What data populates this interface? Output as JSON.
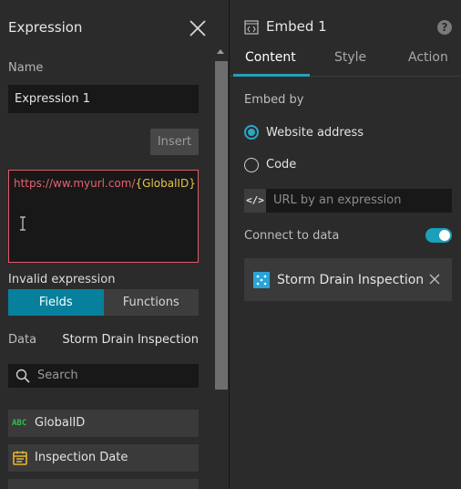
{
  "left": {
    "title": "Expression",
    "name_label": "Name",
    "name_value": "Expression 1",
    "insert_label": "Insert",
    "expression": {
      "url_part": "https://ww.myurl.com/",
      "field_part": "{GlobalID}"
    },
    "error_text": "Invalid expression",
    "tabs": [
      {
        "label": "Fields",
        "active": true
      },
      {
        "label": "Functions",
        "active": false
      }
    ],
    "data_label": "Data",
    "data_value": "Storm Drain Inspection",
    "search_placeholder": "Search",
    "fields": [
      {
        "icon": "abc-string-icon",
        "icon_text": "ABC",
        "name": "GlobalID"
      },
      {
        "icon": "calendar-date-icon",
        "name": "Inspection Date"
      }
    ]
  },
  "right": {
    "title": "Embed 1",
    "tabs": [
      {
        "label": "Content",
        "active": true
      },
      {
        "label": "Style",
        "active": false
      },
      {
        "label": "Action",
        "active": false
      }
    ],
    "embed_by_label": "Embed by",
    "options": [
      {
        "label": "Website address",
        "selected": true
      },
      {
        "label": "Code",
        "selected": false
      }
    ],
    "url_icon_text": "</>",
    "url_placeholder": "URL by an expression",
    "connect_label": "Connect to data",
    "connect_enabled": true,
    "data_source": "Storm Drain Inspection"
  },
  "colors": {
    "accent": "#07809d",
    "error": "#e05b68",
    "field_token": "#e6c34b",
    "toggle": "#1b9fba"
  }
}
